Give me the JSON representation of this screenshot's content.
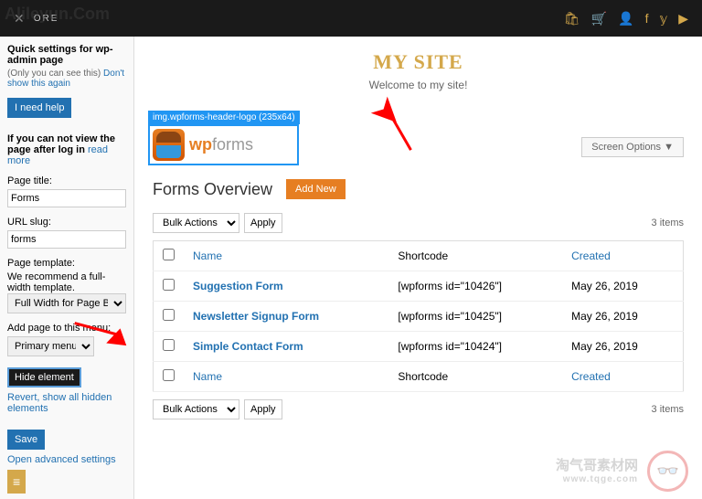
{
  "watermark": "Alileyun.Com",
  "topbar": {
    "brand": "ORE"
  },
  "sidebar": {
    "heading": "Quick settings for wp-admin page",
    "note_prefix": "(Only you can see this) ",
    "note_link": "Don't show this again",
    "help_btn": "I need help",
    "noview_prefix": "If you can not view the page after log in ",
    "noview_link": "read more",
    "page_title_label": "Page title:",
    "page_title_value": "Forms",
    "url_slug_label": "URL slug:",
    "url_slug_value": "forms",
    "template_label": "Page template:",
    "template_note": "We recommend a full-width template.",
    "template_value": "Full Width for Page Builde",
    "menu_label": "Add page to this menu:",
    "menu_value": "Primary menu",
    "hide_btn": "Hide element",
    "revert_link": "Revert, show all hidden elements",
    "save_btn": "Save",
    "advanced_link": "Open advanced settings",
    "burger": "≡"
  },
  "hero": {
    "title": "MY SITE",
    "subtitle": "Welcome to my site!"
  },
  "logo": {
    "tag": "img.wpforms-header-logo (235x64)",
    "text_bold": "wp",
    "text_rest": "forms"
  },
  "screen_options": "Screen Options ▼",
  "page": {
    "title": "Forms Overview",
    "add_new": "Add New",
    "bulk_label": "Bulk Actions",
    "apply": "Apply",
    "items": "3 items",
    "cols": {
      "name": "Name",
      "shortcode": "Shortcode",
      "created": "Created"
    },
    "rows": [
      {
        "name": "Suggestion Form",
        "shortcode": "[wpforms id=\"10426\"]",
        "created": "May 26, 2019"
      },
      {
        "name": "Newsletter Signup Form",
        "shortcode": "[wpforms id=\"10425\"]",
        "created": "May 26, 2019"
      },
      {
        "name": "Simple Contact Form",
        "shortcode": "[wpforms id=\"10424\"]",
        "created": "May 26, 2019"
      }
    ]
  },
  "footer_wm": {
    "line1": "淘气哥素材网",
    "line2": "www.tqge.com"
  }
}
